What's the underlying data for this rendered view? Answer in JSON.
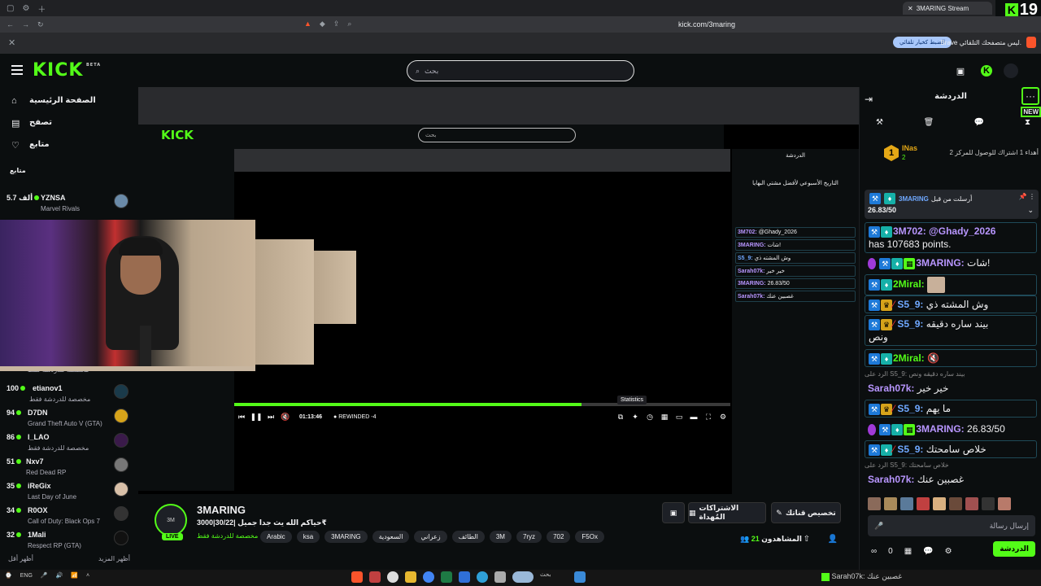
{
  "browser": {
    "tab_title": "3MARING Stream",
    "url": "kick.com/3maring",
    "infobar_message": "Brave ليس متصفحك التلقائي.",
    "infobar_button": "الضبط كخيار تلقائي",
    "live_count": "19"
  },
  "header": {
    "logo": "KICK",
    "logo_beta": "BETA",
    "search_placeholder": "بحث"
  },
  "sidebar": {
    "nav": [
      {
        "label": "الصفحة الرئيسية",
        "icon": "home-icon"
      },
      {
        "label": "تصفح",
        "icon": "browse-icon"
      },
      {
        "label": "متابع",
        "icon": "heart-icon"
      }
    ],
    "section_title": "متابع",
    "channels": [
      {
        "viewers": "5.7 ألف",
        "name": "YZNSA",
        "category": "Marvel Rivals"
      },
      {
        "viewers": "100",
        "name": "etianov1",
        "category": "مخصصة للدردشة فقط"
      },
      {
        "viewers": "94",
        "name": "D7DN",
        "category": "Grand Theft Auto V (GTA)"
      },
      {
        "viewers": "86",
        "name": "I_LAO",
        "category": "مخصصة للدردشة فقط"
      },
      {
        "viewers": "51",
        "name": "Nxv7",
        "category": "Red Dead RP"
      },
      {
        "viewers": "35",
        "name": "iReGix",
        "category": "Last Day of June"
      },
      {
        "viewers": "34",
        "name": "R0OX",
        "category": "Call of Duty: Black Ops 7"
      },
      {
        "viewers": "32",
        "name": "1Mali",
        "category": "Respect RP (GTA)"
      }
    ],
    "hidden_row_category": "مخصصة للدردشة فقط",
    "show_more": "أظهر المزيد",
    "show_less": "أظهر أقل"
  },
  "player": {
    "time": "01:13:46",
    "rewind": "REWINDED -4",
    "tooltip": "Statistics",
    "inner_title": "التاريخ الأسبوعي لأفضل مشتي البهايا"
  },
  "stream": {
    "streamer": "3MARING",
    "live": "LIVE",
    "title": "حياكم الله يث جدا جميل |30/22|3000₹",
    "category": "مخصصة للدردشة فقط",
    "tags": [
      "Arabic",
      "ksa",
      "3MARING",
      "السعودية",
      "زعراني",
      "الطائف",
      "3M",
      "7ryz",
      "702",
      "F5Ox"
    ],
    "customize_button": "تخصيص قناتك",
    "gift_button": "الاشتراكات المُهداة",
    "viewers_label": "المشاهدون",
    "viewers_count": "21"
  },
  "chat": {
    "title": "الدردشة",
    "new_badge": "NEW",
    "pinned_user": "INas",
    "pinned_rank": "1",
    "pinned_sub_count": "2",
    "pinned_desc": "أهداء 1 اشتراك للوصول للمركز 2",
    "pinned_by": "أرسلت من قبل",
    "pinned_author": "3MARING",
    "pinned_value": "26.83/50",
    "messages": [
      {
        "user": "3M702:",
        "text": "@Ghady_2026",
        "cls": "u-violet"
      },
      {
        "user": "",
        "text": "has 107683 points.",
        "cls": ""
      },
      {
        "user": "3MARING:",
        "text": "شات!",
        "cls": "u-violet"
      },
      {
        "user": "2Miral:",
        "text": "",
        "cls": "u-green"
      },
      {
        "user": "S5_9:",
        "text": "وش المشته ذي",
        "cls": "u-blue"
      },
      {
        "user": "S5_9:",
        "text": "بيند ساره دقيقه",
        "cls": "u-blue"
      },
      {
        "user": "",
        "text": "ونص",
        "cls": ""
      },
      {
        "user": "2Miral:",
        "text": "",
        "cls": "u-green"
      },
      {
        "user": "Sarah07k:",
        "text": "خير خير",
        "cls": "u-violet"
      },
      {
        "user": "S5_9:",
        "text": "ما يهم",
        "cls": "u-blue"
      },
      {
        "user": "3MARING:",
        "text": "26.83/50",
        "cls": "u-violet"
      },
      {
        "user": "S5_9:",
        "text": "خلاص سامحتك",
        "cls": "u-blue"
      },
      {
        "user": "Sarah07k:",
        "text": "غصبين عنك",
        "cls": "u-violet"
      }
    ],
    "reply_text": "الرد على S5_9: بيند ساره دقيقه ونص",
    "reply_text2": "الرد على S5_9: خلاص سامحتك",
    "input_placeholder": "إرسال رسالة",
    "send_button": "الدردشة",
    "points": "0"
  },
  "taskbar": {
    "lang": "ENG",
    "search": "بحث",
    "recent": "Sarah07k: غصبين عنك"
  },
  "colors": {
    "accent": "#53fc18",
    "background": "#0b0e0f"
  }
}
